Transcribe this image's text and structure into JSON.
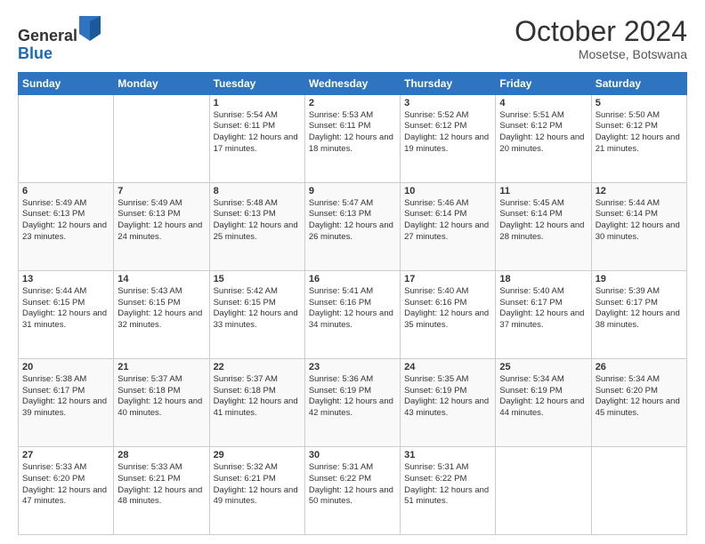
{
  "header": {
    "logo_general": "General",
    "logo_blue": "Blue",
    "month_title": "October 2024",
    "location": "Mosetse, Botswana"
  },
  "days_of_week": [
    "Sunday",
    "Monday",
    "Tuesday",
    "Wednesday",
    "Thursday",
    "Friday",
    "Saturday"
  ],
  "weeks": [
    [
      {
        "day": "",
        "sunrise": "",
        "sunset": "",
        "daylight": ""
      },
      {
        "day": "",
        "sunrise": "",
        "sunset": "",
        "daylight": ""
      },
      {
        "day": "1",
        "sunrise": "Sunrise: 5:54 AM",
        "sunset": "Sunset: 6:11 PM",
        "daylight": "Daylight: 12 hours and 17 minutes."
      },
      {
        "day": "2",
        "sunrise": "Sunrise: 5:53 AM",
        "sunset": "Sunset: 6:11 PM",
        "daylight": "Daylight: 12 hours and 18 minutes."
      },
      {
        "day": "3",
        "sunrise": "Sunrise: 5:52 AM",
        "sunset": "Sunset: 6:12 PM",
        "daylight": "Daylight: 12 hours and 19 minutes."
      },
      {
        "day": "4",
        "sunrise": "Sunrise: 5:51 AM",
        "sunset": "Sunset: 6:12 PM",
        "daylight": "Daylight: 12 hours and 20 minutes."
      },
      {
        "day": "5",
        "sunrise": "Sunrise: 5:50 AM",
        "sunset": "Sunset: 6:12 PM",
        "daylight": "Daylight: 12 hours and 21 minutes."
      }
    ],
    [
      {
        "day": "6",
        "sunrise": "Sunrise: 5:49 AM",
        "sunset": "Sunset: 6:13 PM",
        "daylight": "Daylight: 12 hours and 23 minutes."
      },
      {
        "day": "7",
        "sunrise": "Sunrise: 5:49 AM",
        "sunset": "Sunset: 6:13 PM",
        "daylight": "Daylight: 12 hours and 24 minutes."
      },
      {
        "day": "8",
        "sunrise": "Sunrise: 5:48 AM",
        "sunset": "Sunset: 6:13 PM",
        "daylight": "Daylight: 12 hours and 25 minutes."
      },
      {
        "day": "9",
        "sunrise": "Sunrise: 5:47 AM",
        "sunset": "Sunset: 6:13 PM",
        "daylight": "Daylight: 12 hours and 26 minutes."
      },
      {
        "day": "10",
        "sunrise": "Sunrise: 5:46 AM",
        "sunset": "Sunset: 6:14 PM",
        "daylight": "Daylight: 12 hours and 27 minutes."
      },
      {
        "day": "11",
        "sunrise": "Sunrise: 5:45 AM",
        "sunset": "Sunset: 6:14 PM",
        "daylight": "Daylight: 12 hours and 28 minutes."
      },
      {
        "day": "12",
        "sunrise": "Sunrise: 5:44 AM",
        "sunset": "Sunset: 6:14 PM",
        "daylight": "Daylight: 12 hours and 30 minutes."
      }
    ],
    [
      {
        "day": "13",
        "sunrise": "Sunrise: 5:44 AM",
        "sunset": "Sunset: 6:15 PM",
        "daylight": "Daylight: 12 hours and 31 minutes."
      },
      {
        "day": "14",
        "sunrise": "Sunrise: 5:43 AM",
        "sunset": "Sunset: 6:15 PM",
        "daylight": "Daylight: 12 hours and 32 minutes."
      },
      {
        "day": "15",
        "sunrise": "Sunrise: 5:42 AM",
        "sunset": "Sunset: 6:15 PM",
        "daylight": "Daylight: 12 hours and 33 minutes."
      },
      {
        "day": "16",
        "sunrise": "Sunrise: 5:41 AM",
        "sunset": "Sunset: 6:16 PM",
        "daylight": "Daylight: 12 hours and 34 minutes."
      },
      {
        "day": "17",
        "sunrise": "Sunrise: 5:40 AM",
        "sunset": "Sunset: 6:16 PM",
        "daylight": "Daylight: 12 hours and 35 minutes."
      },
      {
        "day": "18",
        "sunrise": "Sunrise: 5:40 AM",
        "sunset": "Sunset: 6:17 PM",
        "daylight": "Daylight: 12 hours and 37 minutes."
      },
      {
        "day": "19",
        "sunrise": "Sunrise: 5:39 AM",
        "sunset": "Sunset: 6:17 PM",
        "daylight": "Daylight: 12 hours and 38 minutes."
      }
    ],
    [
      {
        "day": "20",
        "sunrise": "Sunrise: 5:38 AM",
        "sunset": "Sunset: 6:17 PM",
        "daylight": "Daylight: 12 hours and 39 minutes."
      },
      {
        "day": "21",
        "sunrise": "Sunrise: 5:37 AM",
        "sunset": "Sunset: 6:18 PM",
        "daylight": "Daylight: 12 hours and 40 minutes."
      },
      {
        "day": "22",
        "sunrise": "Sunrise: 5:37 AM",
        "sunset": "Sunset: 6:18 PM",
        "daylight": "Daylight: 12 hours and 41 minutes."
      },
      {
        "day": "23",
        "sunrise": "Sunrise: 5:36 AM",
        "sunset": "Sunset: 6:19 PM",
        "daylight": "Daylight: 12 hours and 42 minutes."
      },
      {
        "day": "24",
        "sunrise": "Sunrise: 5:35 AM",
        "sunset": "Sunset: 6:19 PM",
        "daylight": "Daylight: 12 hours and 43 minutes."
      },
      {
        "day": "25",
        "sunrise": "Sunrise: 5:34 AM",
        "sunset": "Sunset: 6:19 PM",
        "daylight": "Daylight: 12 hours and 44 minutes."
      },
      {
        "day": "26",
        "sunrise": "Sunrise: 5:34 AM",
        "sunset": "Sunset: 6:20 PM",
        "daylight": "Daylight: 12 hours and 45 minutes."
      }
    ],
    [
      {
        "day": "27",
        "sunrise": "Sunrise: 5:33 AM",
        "sunset": "Sunset: 6:20 PM",
        "daylight": "Daylight: 12 hours and 47 minutes."
      },
      {
        "day": "28",
        "sunrise": "Sunrise: 5:33 AM",
        "sunset": "Sunset: 6:21 PM",
        "daylight": "Daylight: 12 hours and 48 minutes."
      },
      {
        "day": "29",
        "sunrise": "Sunrise: 5:32 AM",
        "sunset": "Sunset: 6:21 PM",
        "daylight": "Daylight: 12 hours and 49 minutes."
      },
      {
        "day": "30",
        "sunrise": "Sunrise: 5:31 AM",
        "sunset": "Sunset: 6:22 PM",
        "daylight": "Daylight: 12 hours and 50 minutes."
      },
      {
        "day": "31",
        "sunrise": "Sunrise: 5:31 AM",
        "sunset": "Sunset: 6:22 PM",
        "daylight": "Daylight: 12 hours and 51 minutes."
      },
      {
        "day": "",
        "sunrise": "",
        "sunset": "",
        "daylight": ""
      },
      {
        "day": "",
        "sunrise": "",
        "sunset": "",
        "daylight": ""
      }
    ]
  ]
}
